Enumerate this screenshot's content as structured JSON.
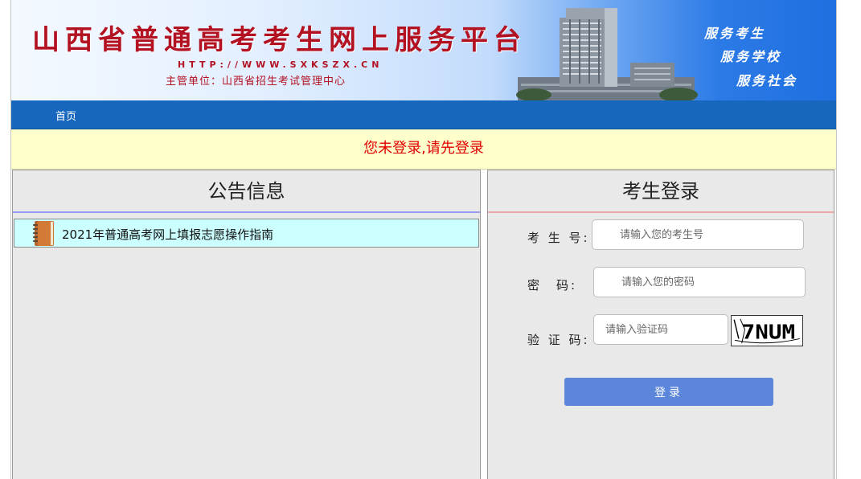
{
  "header": {
    "title": "山西省普通高考考生网上服务平台",
    "url": "HTTP://WWW.SXKSZX.CN",
    "organizer": "主管单位：山西省招生考试管理中心",
    "slogans": [
      "服务考生",
      "服务学校",
      "服务社会"
    ]
  },
  "nav": {
    "home_label": "首页"
  },
  "notice": {
    "text": "您未登录,请先登录"
  },
  "announcements": {
    "title": "公告信息",
    "items": [
      {
        "label": "2021年普通高考网上填报志愿操作指南",
        "icon": "book-icon"
      }
    ]
  },
  "login": {
    "title": "考生登录",
    "id_label": "考 生 号:",
    "id_placeholder": "请输入您的考生号",
    "password_label": "密　码:",
    "password_placeholder": "请输入您的密码",
    "captcha_label": "验 证 码:",
    "captcha_placeholder": "请输入验证码",
    "captcha_text": "7NUM",
    "submit_label": "登录"
  },
  "colors": {
    "title_red": "#b31222",
    "nav_blue": "#1667bd",
    "notice_bg": "#ffffcc",
    "notice_text": "#e00000",
    "announcement_bg": "#ccffff",
    "button_blue": "#5b86d9"
  }
}
